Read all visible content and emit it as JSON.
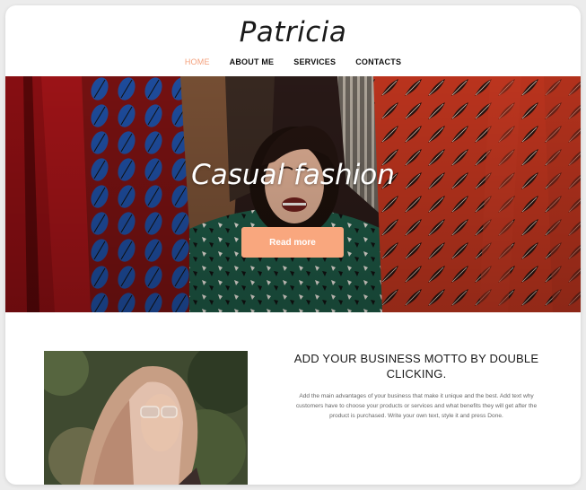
{
  "site": {
    "logo": "Patricia"
  },
  "nav": {
    "items": [
      {
        "label": "HOME",
        "active": true
      },
      {
        "label": "ABOUT ME",
        "active": false
      },
      {
        "label": "SERVICES",
        "active": false
      },
      {
        "label": "CONTACTS",
        "active": false
      }
    ]
  },
  "hero": {
    "title": "Casual fashion",
    "button_label": "Read more"
  },
  "feature": {
    "heading": "ADD YOUR BUSINESS MOTTO BY DOUBLE CLICKING.",
    "body": "Add the main advantages of your business that make it unique and the best. Add text why customers have to choose your products or services and what benefits they will get after the product is purchased. Write your own text, style it and press Done."
  },
  "colors": {
    "accent": "#f9a77e",
    "nav_active": "#f4a07c",
    "text": "#111111"
  }
}
